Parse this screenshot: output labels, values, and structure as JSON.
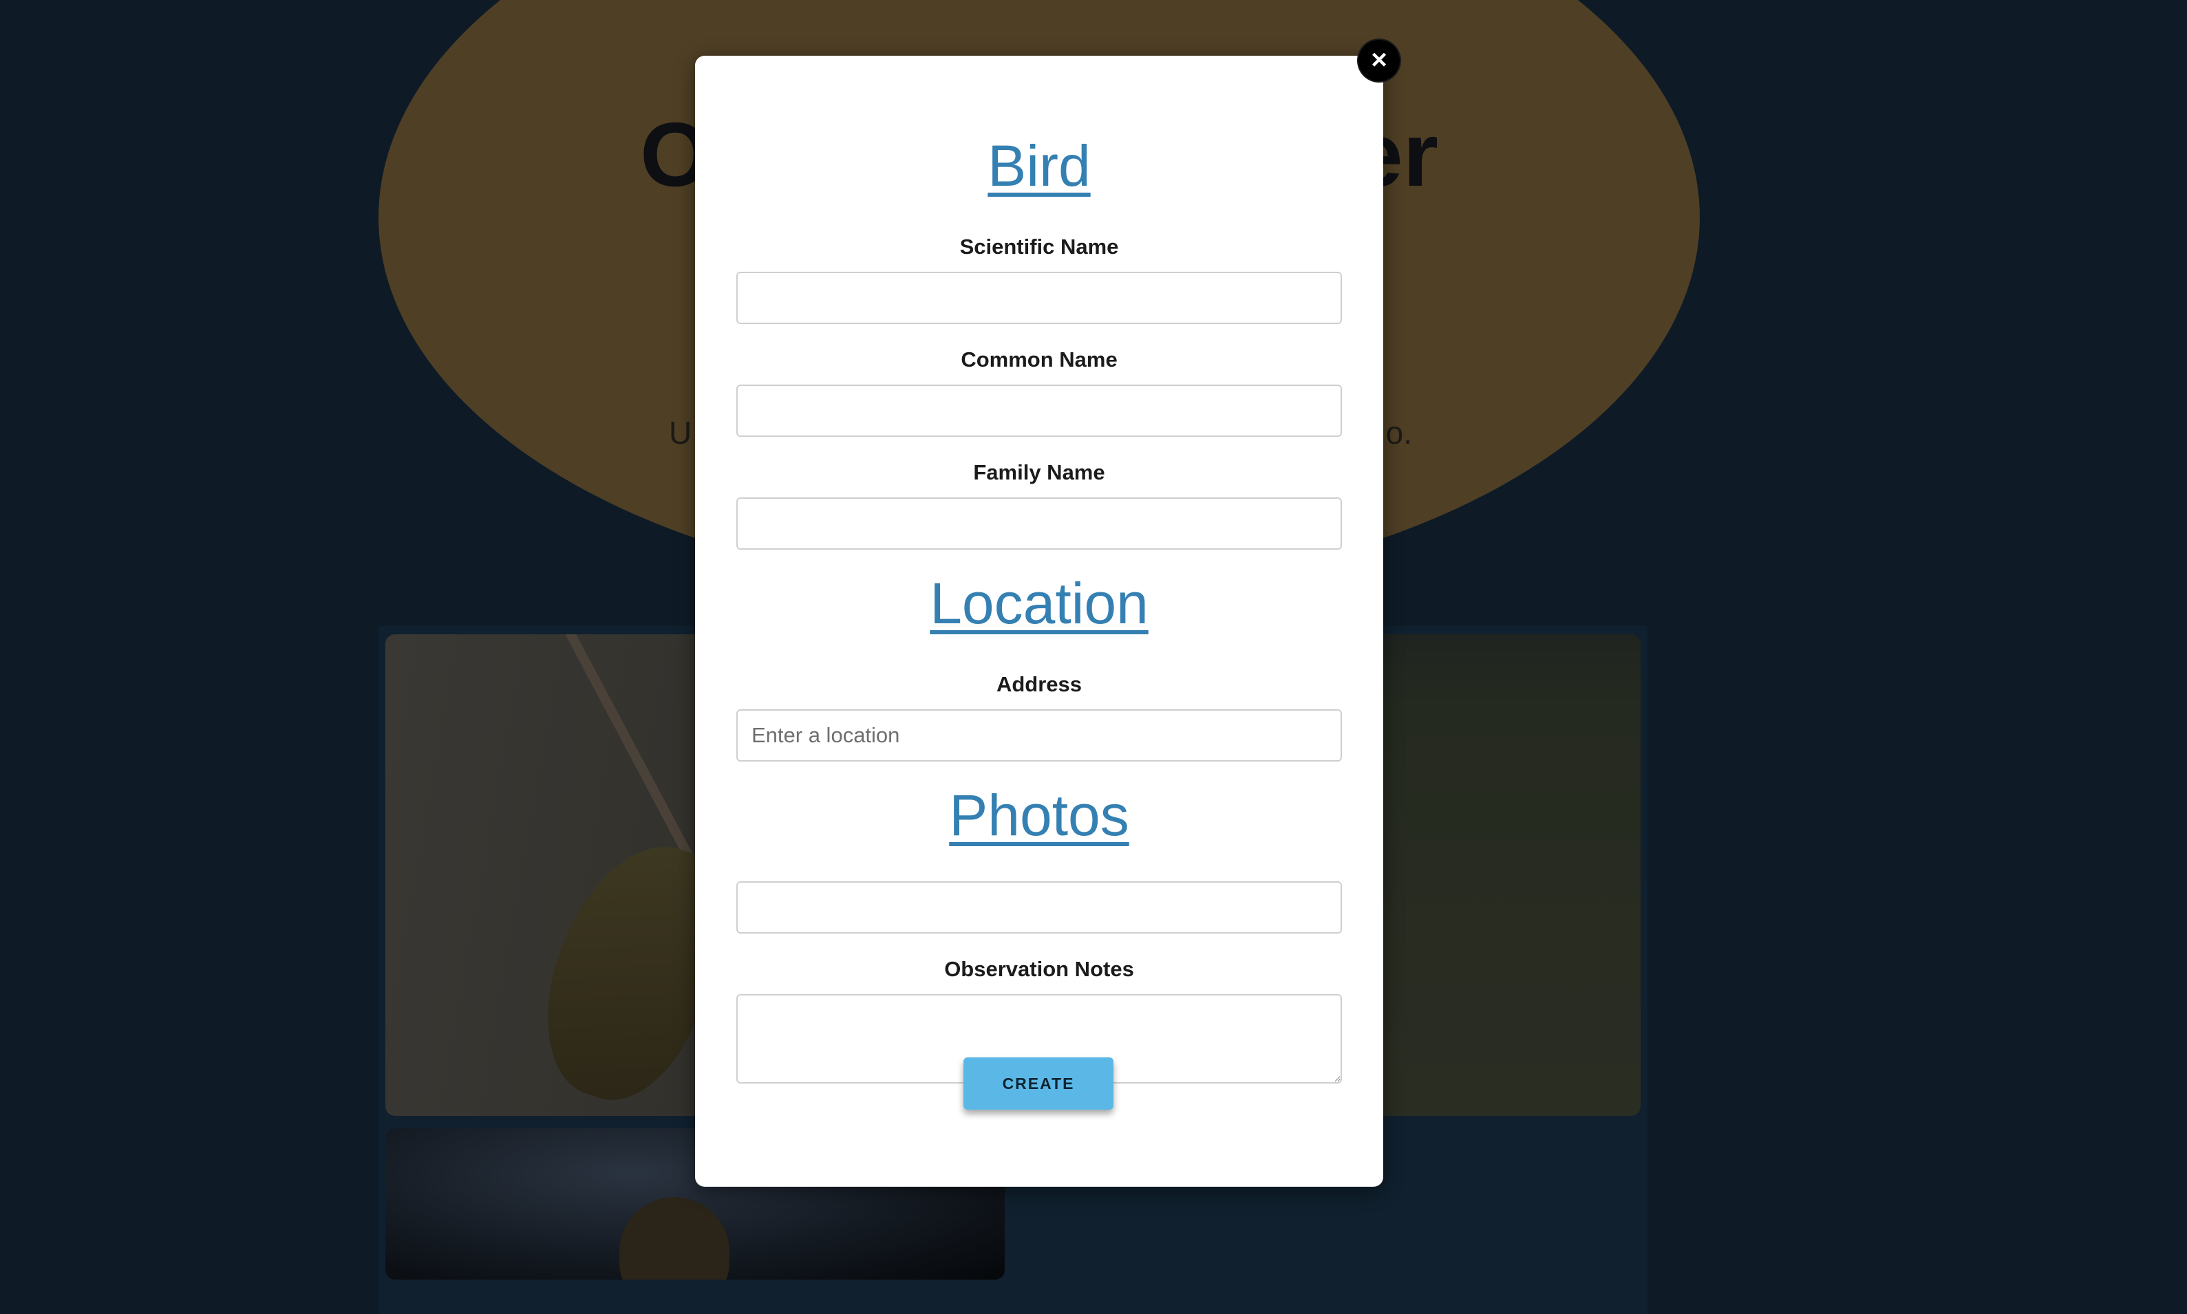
{
  "background": {
    "hero_title_left": "O",
    "hero_title_right": "er",
    "hero_sub_left": "U",
    "hero_sub_right": "o."
  },
  "modal": {
    "close_label": "×",
    "sections": {
      "bird": "Bird",
      "location": "Location",
      "photos": "Photos"
    },
    "fields": {
      "scientific_name": {
        "label": "Scientific Name",
        "value": ""
      },
      "common_name": {
        "label": "Common Name",
        "value": ""
      },
      "family_name": {
        "label": "Family Name",
        "value": ""
      },
      "address": {
        "label": "Address",
        "value": "",
        "placeholder": "Enter a location"
      },
      "photo_url": {
        "value": ""
      },
      "observation_notes": {
        "label": "Observation Notes",
        "value": ""
      }
    },
    "create_label": "CREATE"
  },
  "colors": {
    "accent": "#3580b2",
    "button": "#5bb8e6",
    "overlay_bg": "#0e1b27",
    "hero_oval": "#4f3f25"
  }
}
